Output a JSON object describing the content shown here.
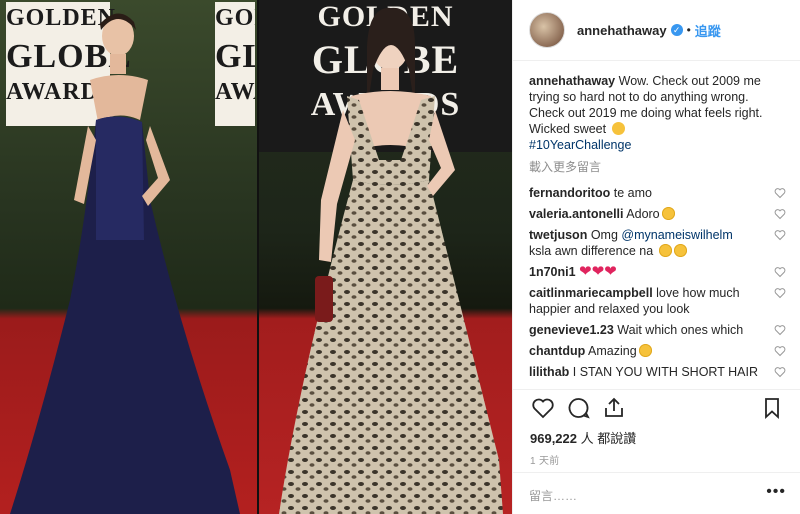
{
  "header": {
    "username": "annehathaway",
    "follow_label": "追蹤",
    "dot": "•"
  },
  "photo": {
    "sign_left": [
      "GOLDEN",
      "GLOBE",
      "AWARDS"
    ],
    "sign_right": [
      "GOLDEN",
      "GLOBE",
      "AWARDS"
    ]
  },
  "caption": {
    "username": "annehathaway",
    "text": "Wow. Check out 2009 me trying so hard not to do anything wrong. Check out 2019 me doing what feels right.",
    "line2": "Wicked sweet",
    "hashtag": "#10YearChallenge"
  },
  "load_more": "載入更多留言",
  "comments": [
    {
      "user": "fernandoritoo",
      "text": "te amo",
      "emoji": ""
    },
    {
      "user": "valeria.antonelli",
      "text": "Adoro",
      "emoji": "heart-eyes"
    },
    {
      "user": "twetjuson",
      "text": "Omg",
      "mention": "@mynameiswilhelm",
      "text2": "ksla awn difference na",
      "emoji": "heart-eyes"
    },
    {
      "user": "1n70ni1",
      "text": "",
      "emoji": "red-hearts"
    },
    {
      "user": "caitlinmariecampbell",
      "text": "love how much happier and relaxed you look",
      "emoji": ""
    },
    {
      "user": "genevieve1.23",
      "text": "Wait which ones which",
      "emoji": ""
    },
    {
      "user": "chantdup",
      "text": "Amazing",
      "emoji": "heart-eyes"
    },
    {
      "user": "lilithab",
      "text": "I STAN YOU WITH SHORT HAIR",
      "emoji": ""
    }
  ],
  "likes": {
    "count": "969,222",
    "suffix": "人 都說讚"
  },
  "time": "1 天前",
  "add_comment": {
    "placeholder": "留言……",
    "more": "•••"
  },
  "icons": [
    "heart-icon",
    "comment-icon",
    "share-icon",
    "bookmark-icon"
  ],
  "colors": {
    "link": "#3897f0",
    "hashtag": "#003569",
    "muted": "#8e8e8e"
  }
}
